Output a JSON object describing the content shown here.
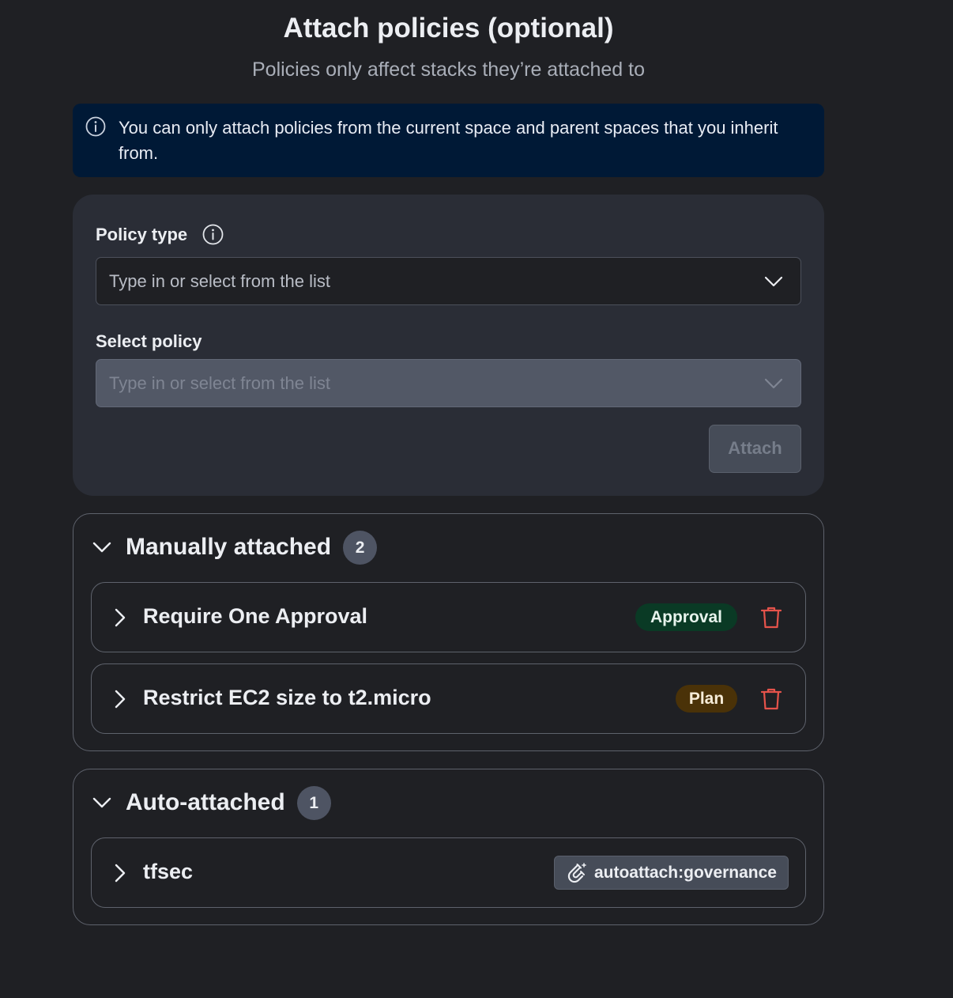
{
  "header": {
    "title": "Attach policies (optional)",
    "subtitle": "Policies only affect stacks they’re attached to"
  },
  "info_banner": {
    "text": "You can only attach policies from the current space and parent spaces that you inherit from.",
    "icon": "info-circle-icon"
  },
  "form": {
    "policy_type": {
      "label": "Policy type",
      "placeholder": "Type in or select from the list",
      "icon": "info-circle-icon"
    },
    "select_policy": {
      "label": "Select policy",
      "placeholder": "Type in or select from the list",
      "disabled": true
    },
    "attach_label": "Attach"
  },
  "manually_attached": {
    "title": "Manually attached",
    "count": "2",
    "items": [
      {
        "name": "Require One Approval",
        "type": "Approval",
        "type_color": "#0a3a25"
      },
      {
        "name": "Restrict EC2 size to t2.micro",
        "type": "Plan",
        "type_color": "#4a3208"
      }
    ]
  },
  "auto_attached": {
    "title": "Auto-attached",
    "count": "1",
    "items": [
      {
        "name": "tfsec",
        "label": "autoattach:governance",
        "label_icon": "magnet-icon"
      }
    ]
  },
  "colors": {
    "background": "#1f2024",
    "banner": "#001936",
    "card": "#2a2d36",
    "danger": "#e5534b"
  }
}
